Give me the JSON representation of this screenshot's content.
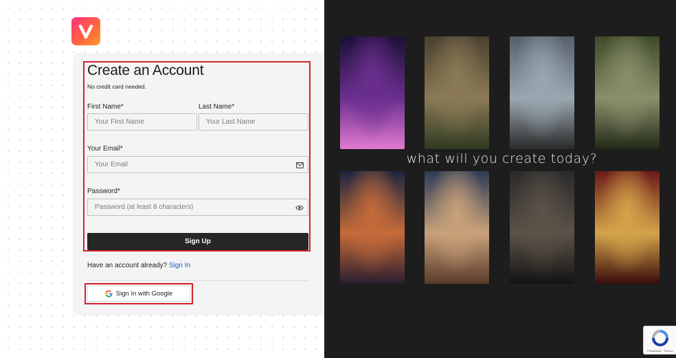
{
  "logo": {
    "letter": "V"
  },
  "form": {
    "title": "Create an Account",
    "subtitle": "No credit card needed.",
    "first_name": {
      "label": "First Name*",
      "placeholder": "Your First Name"
    },
    "last_name": {
      "label": "Last Name*",
      "placeholder": "Your Last Name"
    },
    "email": {
      "label": "Your Email*",
      "placeholder": "Your Email",
      "icon": "envelope-icon"
    },
    "password": {
      "label": "Password*",
      "placeholder": "Password (at least 8 characters)",
      "icon": "eye-icon"
    },
    "signup_label": "Sign Up",
    "have_account_text": "Have an account already?",
    "signin_link": "Sign In",
    "google_label": "Sign In with Google"
  },
  "gallery": {
    "tagline": "what will you create today?",
    "tiles": [
      {
        "subject": "cosmic-wanderer",
        "colors": [
          "#1b1036",
          "#6b2f8f",
          "#e07ad0"
        ]
      },
      {
        "subject": "ruined-capitol",
        "colors": [
          "#4a4030",
          "#8b7a55",
          "#2e3a22"
        ]
      },
      {
        "subject": "pirate-ship",
        "colors": [
          "#55606a",
          "#9aa7b0",
          "#2b2b2b"
        ]
      },
      {
        "subject": "dinosaur",
        "colors": [
          "#3e4a2a",
          "#8a8f6a",
          "#222a18"
        ]
      },
      {
        "subject": "sci-fi-city",
        "colors": [
          "#1c2540",
          "#c66b3a",
          "#2a1e2e"
        ]
      },
      {
        "subject": "space-heroine",
        "colors": [
          "#2b3a55",
          "#c9a27a",
          "#5a3a2a"
        ]
      },
      {
        "subject": "dark-alley",
        "colors": [
          "#2a2a2a",
          "#5c5248",
          "#141414"
        ]
      },
      {
        "subject": "royal-bride",
        "colors": [
          "#6a1a1a",
          "#d4a44a",
          "#3a0c0c"
        ]
      }
    ]
  },
  "recaptcha": {
    "text": "Privacidade - Termos"
  },
  "colors": {
    "accent": "#1f5fbf",
    "highlight": "#d0202a",
    "dark_button": "#262626"
  }
}
